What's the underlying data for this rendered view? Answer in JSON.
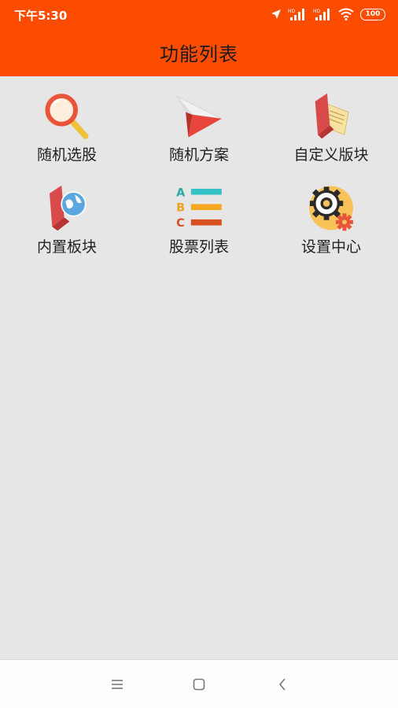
{
  "status_bar": {
    "time": "下午5:30",
    "signal_1_label": "HD",
    "signal_2_label": "HD",
    "battery_level": "100",
    "icons": [
      "location-arrow-icon",
      "signal-hd-icon",
      "signal-hd-icon",
      "wifi-icon",
      "battery-icon"
    ]
  },
  "header": {
    "title": "功能列表",
    "background_color": "#fb4c00"
  },
  "menu": {
    "items": [
      {
        "label": "随机选股",
        "icon": "magnifier-icon"
      },
      {
        "label": "随机方案",
        "icon": "paper-plane-icon"
      },
      {
        "label": "自定义版块",
        "icon": "folder-document-icon"
      },
      {
        "label": "内置板块",
        "icon": "folder-globe-icon"
      },
      {
        "label": "股票列表",
        "icon": "abc-list-icon"
      },
      {
        "label": "设置中心",
        "icon": "gears-icon"
      }
    ],
    "abc_letters": [
      "A",
      "B",
      "C"
    ]
  },
  "nav_bar": {
    "buttons": [
      "menu-icon",
      "home-icon",
      "back-icon"
    ]
  }
}
